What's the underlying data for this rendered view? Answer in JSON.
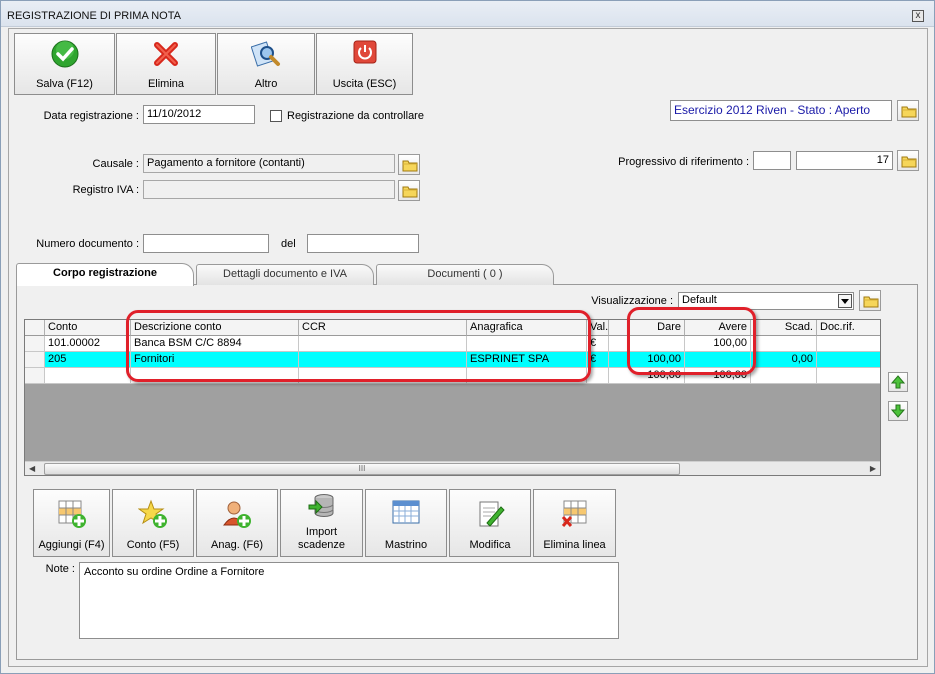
{
  "window": {
    "title": "REGISTRAZIONE DI PRIMA NOTA",
    "close_glyph": "x"
  },
  "toolbar": {
    "save": "Salva (F12)",
    "delete": "Elimina",
    "other": "Altro",
    "exit": "Uscita (ESC)"
  },
  "form": {
    "data_label": "Data registrazione :",
    "data_value": "11/10/2012",
    "check_label": "Registrazione da controllare",
    "esercizio": "Esercizio 2012 Riven - Stato : Aperto",
    "causale_label": "Causale :",
    "causale_value": "Pagamento a fornitore (contanti)",
    "registro_label": "Registro IVA :",
    "registro_value": "",
    "progressivo_label": "Progressivo di riferimento :",
    "progressivo_prefix": "",
    "progressivo_value": "17",
    "numero_label": "Numero documento :",
    "numero_value": "",
    "del_label": "del",
    "del_value": ""
  },
  "tabs": [
    "Corpo registrazione",
    "Dettagli documento e IVA",
    "Documenti ( 0 )"
  ],
  "view": {
    "label": "Visualizzazione :",
    "value": "Default"
  },
  "grid": {
    "headers": [
      "Conto",
      "Descrizione conto",
      "CCR",
      "Anagrafica",
      "Val.",
      "Dare",
      "Avere",
      "Scad.",
      "Doc.rif."
    ],
    "rows": [
      [
        "101.00002",
        "Banca BSM C/C 8894",
        "",
        "",
        "€",
        "",
        "100,00",
        "",
        ""
      ],
      [
        "205",
        "Fornitori",
        "",
        "ESPRINET SPA",
        "€",
        "100,00",
        "",
        "0,00",
        ""
      ],
      [
        "",
        "",
        "",
        "",
        "",
        "100,00",
        "100,00",
        "",
        ""
      ]
    ],
    "scroll_grip": "III"
  },
  "actions": {
    "add": "Aggiungi (F4)",
    "conto": "Conto (F5)",
    "anag": "Anag. (F6)",
    "import_1": "Import",
    "import_2": "scadenze",
    "mastrino": "Mastrino",
    "modifica": "Modifica",
    "elimina_linea": "Elimina linea"
  },
  "note": {
    "label": "Note :",
    "value": "Acconto su ordine Ordine a Fornitore"
  },
  "colors": {
    "selected_row": "#00ffff",
    "highlight": "#e0202a",
    "esercizio_text": "#1a1aa8"
  }
}
